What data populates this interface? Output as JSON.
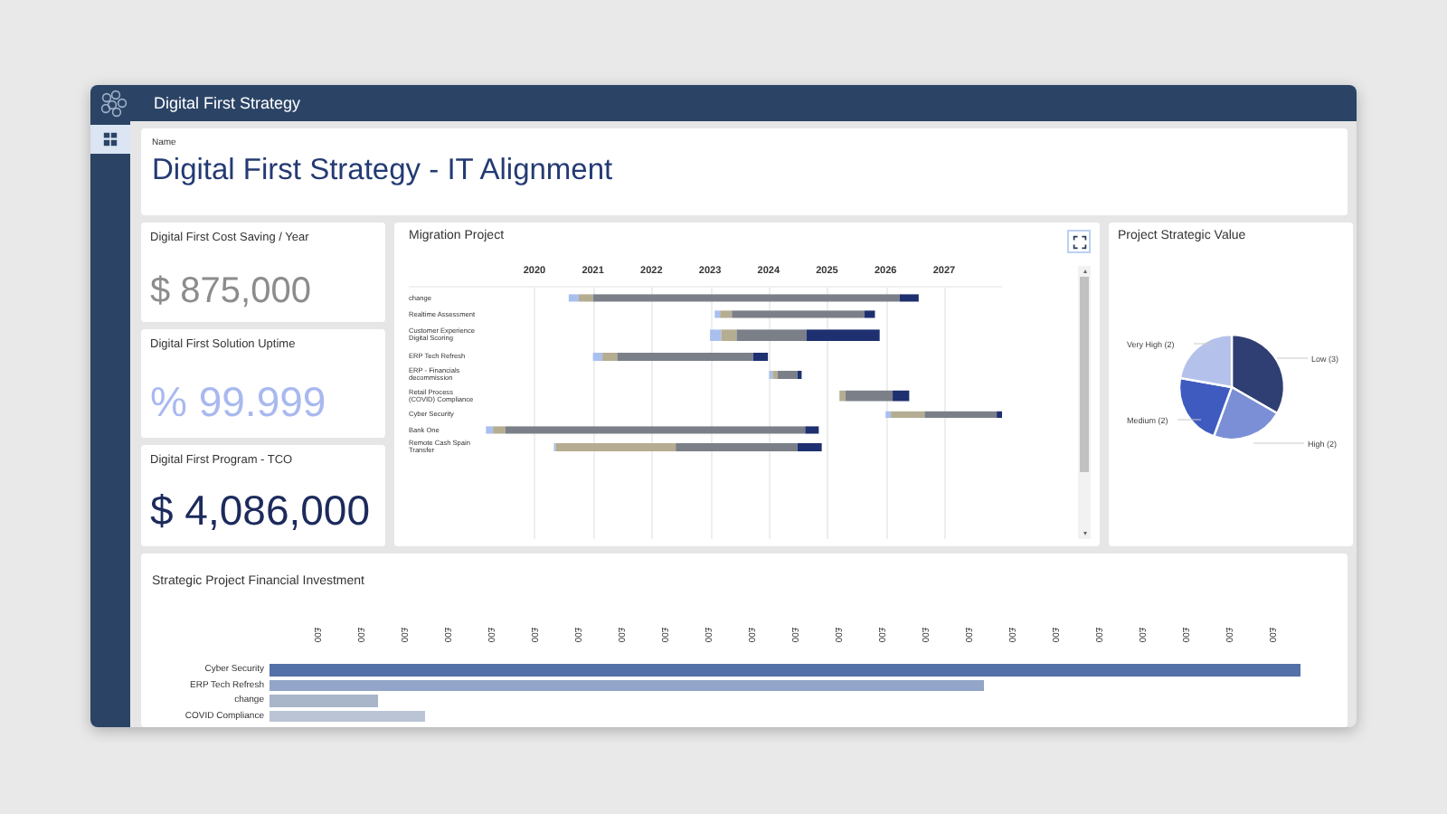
{
  "window": {
    "title": "Digital First Strategy"
  },
  "header": {
    "label": "Name",
    "title": "Digital First Strategy - IT Alignment"
  },
  "kpis": [
    {
      "label": "Digital First Cost Saving / Year",
      "value": "$ 875,000",
      "color": "#8c8c8c"
    },
    {
      "label": "Digital First Solution Uptime",
      "value": "% 99.999",
      "color": "#a9b9ef"
    },
    {
      "label": "Digital First Program - TCO",
      "value": "$ 4,086,000",
      "color": "#1c2a5c"
    }
  ],
  "migration": {
    "title": "Migration Project",
    "years": [
      "2020",
      "2021",
      "2022",
      "2023",
      "2024",
      "2025",
      "2026",
      "2027"
    ],
    "rows": [
      {
        "label": "change"
      },
      {
        "label": "Realtime Assessment"
      },
      {
        "label": "Customer Experience Digital Scoring"
      },
      {
        "label": "ERP Tech Refresh"
      },
      {
        "label": "ERP - Financials decommission"
      },
      {
        "label": "Retail Process (COVID) Compliance"
      },
      {
        "label": "Cyber Security"
      },
      {
        "label": "Bank One"
      },
      {
        "label": "Remote Cash Spain Transfer"
      }
    ]
  },
  "strategic_value": {
    "chart_data": {
      "type": "pie",
      "title": "Project Strategic Value",
      "categories": [
        "Low (3)",
        "High (2)",
        "Medium (2)",
        "Very High (2)"
      ],
      "values": [
        3,
        2,
        2,
        2
      ]
    }
  },
  "investment": {
    "title": "Strategic Project Financial Investment",
    "tick_labels": [
      "£00",
      "£00",
      "£00",
      "£00",
      "£00",
      "£00",
      "£00",
      "£00",
      "£00",
      "£00",
      "£00",
      "£00",
      "£00",
      "£00",
      "£00",
      "£00",
      "£00",
      "£00",
      "£00",
      "£00",
      "£00",
      "£00",
      "£00"
    ],
    "rows": [
      {
        "label": "Cyber Security"
      },
      {
        "label": "ERP Tech Refresh"
      },
      {
        "label": "change"
      },
      {
        "label": "COVID Compliance"
      }
    ]
  }
}
